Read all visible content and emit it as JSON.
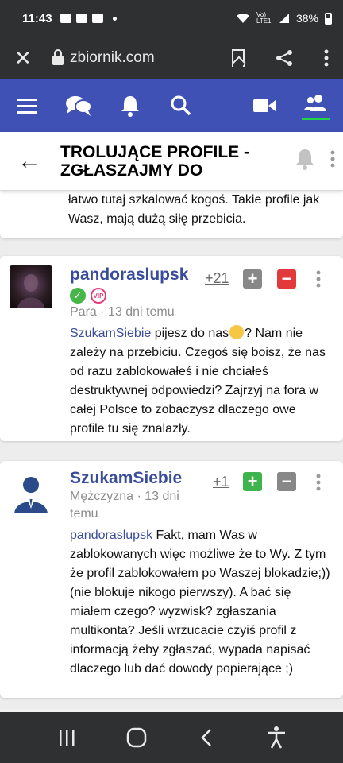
{
  "status_bar": {
    "time": "11:43",
    "battery_text": "38%",
    "network_label": "Vo) LTE1"
  },
  "browser": {
    "url": "zbiornik.com"
  },
  "thread": {
    "title": "TROLUJĄCE PROFILE - ZGŁASZAJMY DO"
  },
  "previous_post": {
    "text": "Także pomysł spoko, ale bez kontroli z góry łatwo tutaj szkalować kogoś. Takie profile jak Wasz, mają dużą siłę przebicia."
  },
  "posts": [
    {
      "username": "pandoraslupsk",
      "badges": [
        "check",
        "VIP"
      ],
      "meta": "Para · 13 dni temu",
      "score": "+21",
      "mention": "SzukamSiebie",
      "body_part1": " pijesz do nas",
      "body_part2": "? Nam nie zależy na przebiciu. Czegoś się boisz, że nas od razu zablokowałeś i nie chciałeś destruktywnej odpowiedzi? Zajrzyj na fora w całej Polsce to zobaczysz dlaczego owe profile tu się znalazły.",
      "up_label": "+",
      "down_label": "−"
    },
    {
      "username": "SzukamSiebie",
      "meta": "Mężczyzna · 13 dni temu",
      "score": "+1",
      "mention": "pandoraslupsk",
      "body": " Fakt, mam Was w zablokowanych więc możliwe że to Wy. Z tym że profil zablokowałem po Waszej blokadzie;))(nie blokuje nikogo pierwszy). A bać się miałem czego? wyzwisk? zgłaszania multikonta? Jeśli wrzucacie czyiś profil z informacją żeby zgłaszać, wypada napisać dlaczego lub dać dowody popierające ;)",
      "up_label": "+",
      "down_label": "−"
    }
  ],
  "colors": {
    "nav_bg": "#3f51b5",
    "link": "#3a4d9a",
    "vote_red": "#e23a3a",
    "vote_green": "#3eb44c",
    "vote_gray": "#888888",
    "active_tab_indicator": "#22d14a"
  }
}
